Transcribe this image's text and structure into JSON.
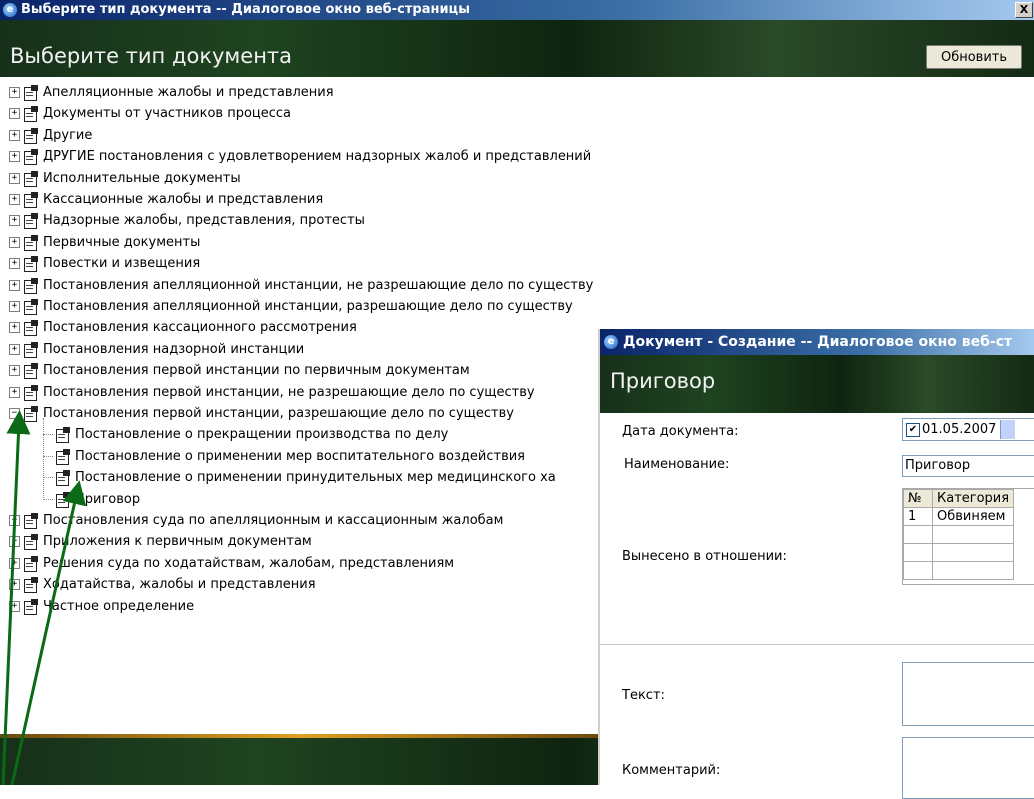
{
  "main_window": {
    "title": "Выберите тип документа -- Диалоговое окно веб-страницы",
    "close_glyph": "X",
    "header_title": "Выберите тип документа",
    "refresh_label": "Обновить"
  },
  "tree": {
    "items": [
      "Апелляционные жалобы и представления",
      "Документы от участников процесса",
      "Другие",
      "ДРУГИЕ постановления с удовлетворением надзорных  жалоб и представлений",
      "Исполнительные документы",
      "Кассационные жалобы и представления",
      "Надзорные жалобы, представления, протесты",
      "Первичные документы",
      "Повестки и извещения",
      "Постановления апелляционной инстанции, не разрешающие дело по существу",
      "Постановления апелляционной инстанции, разрешающие дело по существу",
      "Постановления кассационного рассмотрения",
      "Постановления надзорной инстанции",
      "Постановления первой инстанции по первичным документам",
      "Постановления первой инстанции, не разрешающие дело по существу",
      "Постановления первой инстанции, разрешающие дело по существу"
    ],
    "children": [
      "Постановление о прекращении производства по делу",
      "Постановление о применении мер воспитательного воздействия",
      "Постановление о применении принудительных мер медицинского ха",
      "Приговор"
    ],
    "items_after": [
      "Постановления суда по апелляционным и кассационным жалобам",
      "Приложения к первичным документам",
      "Решения суда по ходатайствам, жалобам, представлениям",
      "Ходатайства, жалобы и представления",
      "Частное определение"
    ],
    "expanded_marker": "−",
    "collapsed_marker": "+"
  },
  "doc_window": {
    "title": "Документ - Создание -- Диалоговое окно веб-ст",
    "header_title": "Приговор",
    "labels": {
      "date": "Дата документа:",
      "name": "Наименование:",
      "issued_for": "Вынесено в отношении:",
      "text": "Текст:",
      "comment": "Комментарий:"
    },
    "date_value": "01.05.2007",
    "date_checked": "✔",
    "name_value": "Приговор",
    "table": {
      "headers": [
        "№",
        "Категория"
      ],
      "rows": [
        [
          "1",
          "Обвиняем"
        ]
      ]
    }
  },
  "colors": {
    "arrow": "#0a6a16",
    "titlebar": "#0a246a",
    "header_bg": "#17301a"
  }
}
